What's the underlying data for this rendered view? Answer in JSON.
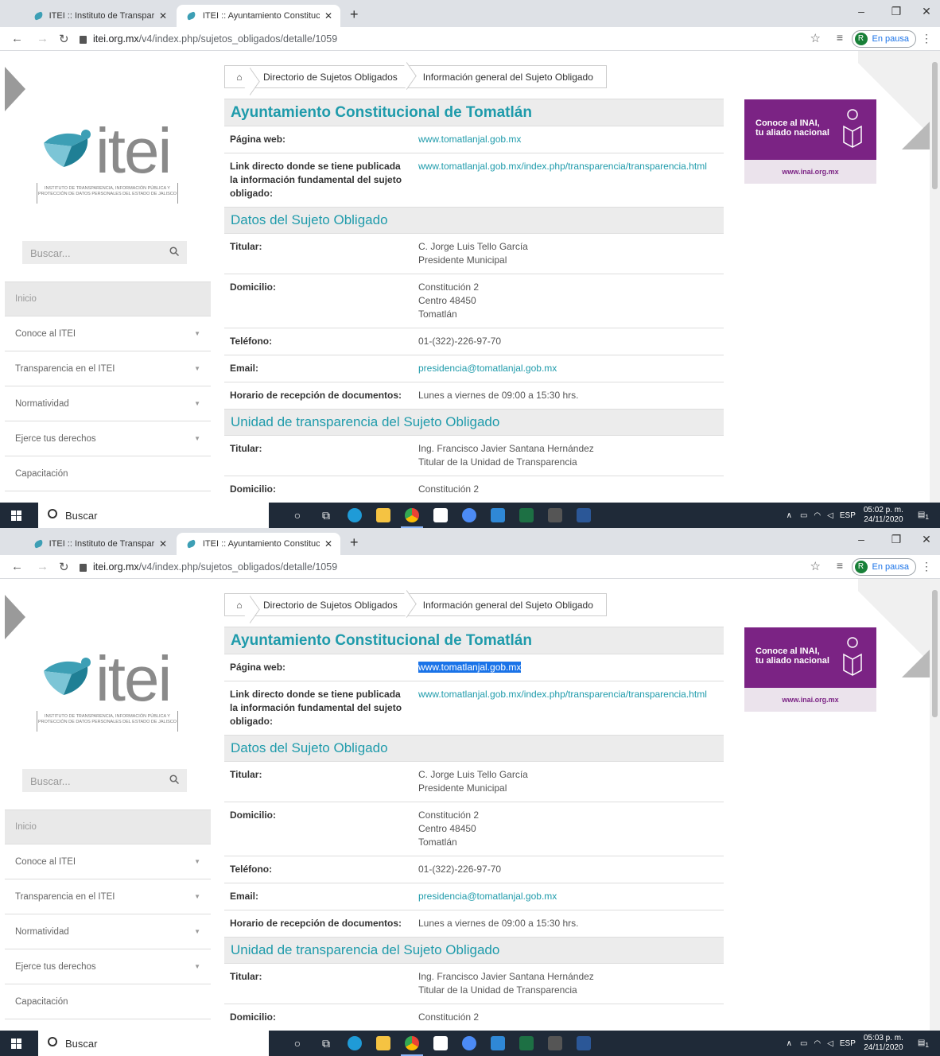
{
  "screens": [
    {
      "tabs": [
        {
          "title": "ITEI :: Instituto de Transparencia, I"
        },
        {
          "title": "ITEI :: Ayuntamiento Constitucion"
        }
      ],
      "url_host": "itei.org.mx",
      "url_path": "/v4/index.php/sujetos_obligados/detalle/1059",
      "profile_initial": "R",
      "profile_status": "En pausa",
      "clock_time": "05:02 p. m.",
      "clock_date": "24/11/2020",
      "selected_web": false
    },
    {
      "tabs": [
        {
          "title": "ITEI :: Instituto de Transparencia, I"
        },
        {
          "title": "ITEI :: Ayuntamiento Constitucion"
        }
      ],
      "url_host": "itei.org.mx",
      "url_path": "/v4/index.php/sujetos_obligados/detalle/1059",
      "profile_initial": "R",
      "profile_status": "En pausa",
      "clock_time": "05:03 p. m.",
      "clock_date": "24/11/2020",
      "selected_web": true
    }
  ],
  "logo": {
    "word": "itei",
    "subtitle": "INSTITUTO DE TRANSPARENCIA, INFORMACIÓN PÚBLICA Y PROTECCIÓN DE DATOS PERSONALES DEL ESTADO DE JALISCO"
  },
  "search_placeholder": "Buscar...",
  "sidenav": [
    {
      "label": "Inicio",
      "has_caret": false
    },
    {
      "label": "Conoce al ITEI",
      "has_caret": true
    },
    {
      "label": "Transparencia en el ITEI",
      "has_caret": true
    },
    {
      "label": "Normatividad",
      "has_caret": true
    },
    {
      "label": "Ejerce tus derechos",
      "has_caret": true
    },
    {
      "label": "Capacitación",
      "has_caret": false
    }
  ],
  "breadcrumb": [
    "Directorio de Sujetos Obligados",
    "Información general del Sujeto Obligado"
  ],
  "title": "Ayuntamiento Constitucional de Tomatlán",
  "general_rows": [
    {
      "key": "Página web:",
      "value": "www.tomatlanjal.gob.mx",
      "link": true
    },
    {
      "key": "Link directo donde se tiene publicada la información fundamental del sujeto obligado:",
      "value": "www.tomatlanjal.gob.mx/index.php/transparencia/transparencia.html",
      "link": true
    }
  ],
  "section_datos": "Datos del Sujeto Obligado",
  "datos_rows": [
    {
      "key": "Titular:",
      "lines": [
        "C. Jorge Luis Tello García",
        "Presidente Municipal"
      ],
      "link": false
    },
    {
      "key": "Domicilio:",
      "lines": [
        "Constitución 2",
        "Centro 48450",
        "Tomatlán"
      ],
      "link": false
    },
    {
      "key": "Teléfono:",
      "lines": [
        "01-(322)-226-97-70"
      ],
      "link": false
    },
    {
      "key": "Email:",
      "lines": [
        "presidencia@tomatlanjal.gob.mx"
      ],
      "link": true
    },
    {
      "key": "Horario de recepción de documentos:",
      "lines": [
        "Lunes a viernes de 09:00 a 15:30 hrs."
      ],
      "link": false
    }
  ],
  "section_unidad": "Unidad de transparencia del Sujeto Obligado",
  "unidad_rows": [
    {
      "key": "Titular:",
      "lines": [
        "Ing. Francisco Javier Santana Hernández",
        "Titular de la Unidad de Transparencia"
      ],
      "link": false
    },
    {
      "key": "Domicilio:",
      "lines": [
        "Constitución 2"
      ],
      "link": false
    }
  ],
  "ad": {
    "line1": "Conoce al INAI,",
    "line2": "tu aliado nacional",
    "url": "www.inai.org.mx",
    "brand_color": "#7b2384"
  },
  "taskbar": {
    "search_label": "Buscar",
    "lang": "ESP",
    "notif_count": "1"
  },
  "colors": {
    "accent": "#1f9bab",
    "taskbar": "#1f2a38"
  }
}
